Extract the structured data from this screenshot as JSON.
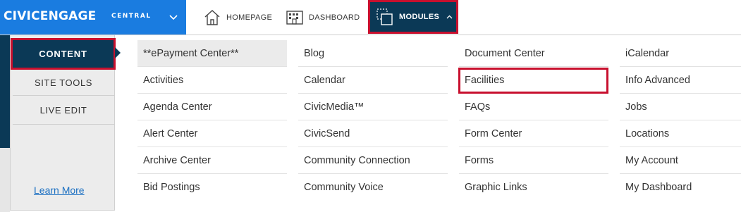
{
  "brand": {
    "name": "CIVICENGAGE",
    "sub": "CENTRAL"
  },
  "nav": {
    "home": "HOMEPAGE",
    "dashboard": "DASHBOARD",
    "modules": "MODULES"
  },
  "side": {
    "items": [
      "CONTENT",
      "SITE TOOLS",
      "LIVE EDIT"
    ],
    "learn_more": "Learn More"
  },
  "columns": [
    [
      "**ePayment Center**",
      "Activities",
      "Agenda Center",
      "Alert Center",
      "Archive Center",
      "Bid Postings"
    ],
    [
      "Blog",
      "Calendar",
      "CivicMedia™",
      "CivicSend",
      "Community Connection",
      "Community Voice"
    ],
    [
      "Document Center",
      "Facilities",
      "FAQs",
      "Form Center",
      "Forms",
      "Graphic Links"
    ],
    [
      "iCalendar",
      "Info Advanced",
      "Jobs",
      "Locations",
      "My Account",
      "My Dashboard"
    ]
  ],
  "colors": {
    "brand_blue": "#1a7ce0",
    "navy": "#0b3956",
    "highlight_red": "#c8102e",
    "link_blue": "#1a6fc2"
  }
}
